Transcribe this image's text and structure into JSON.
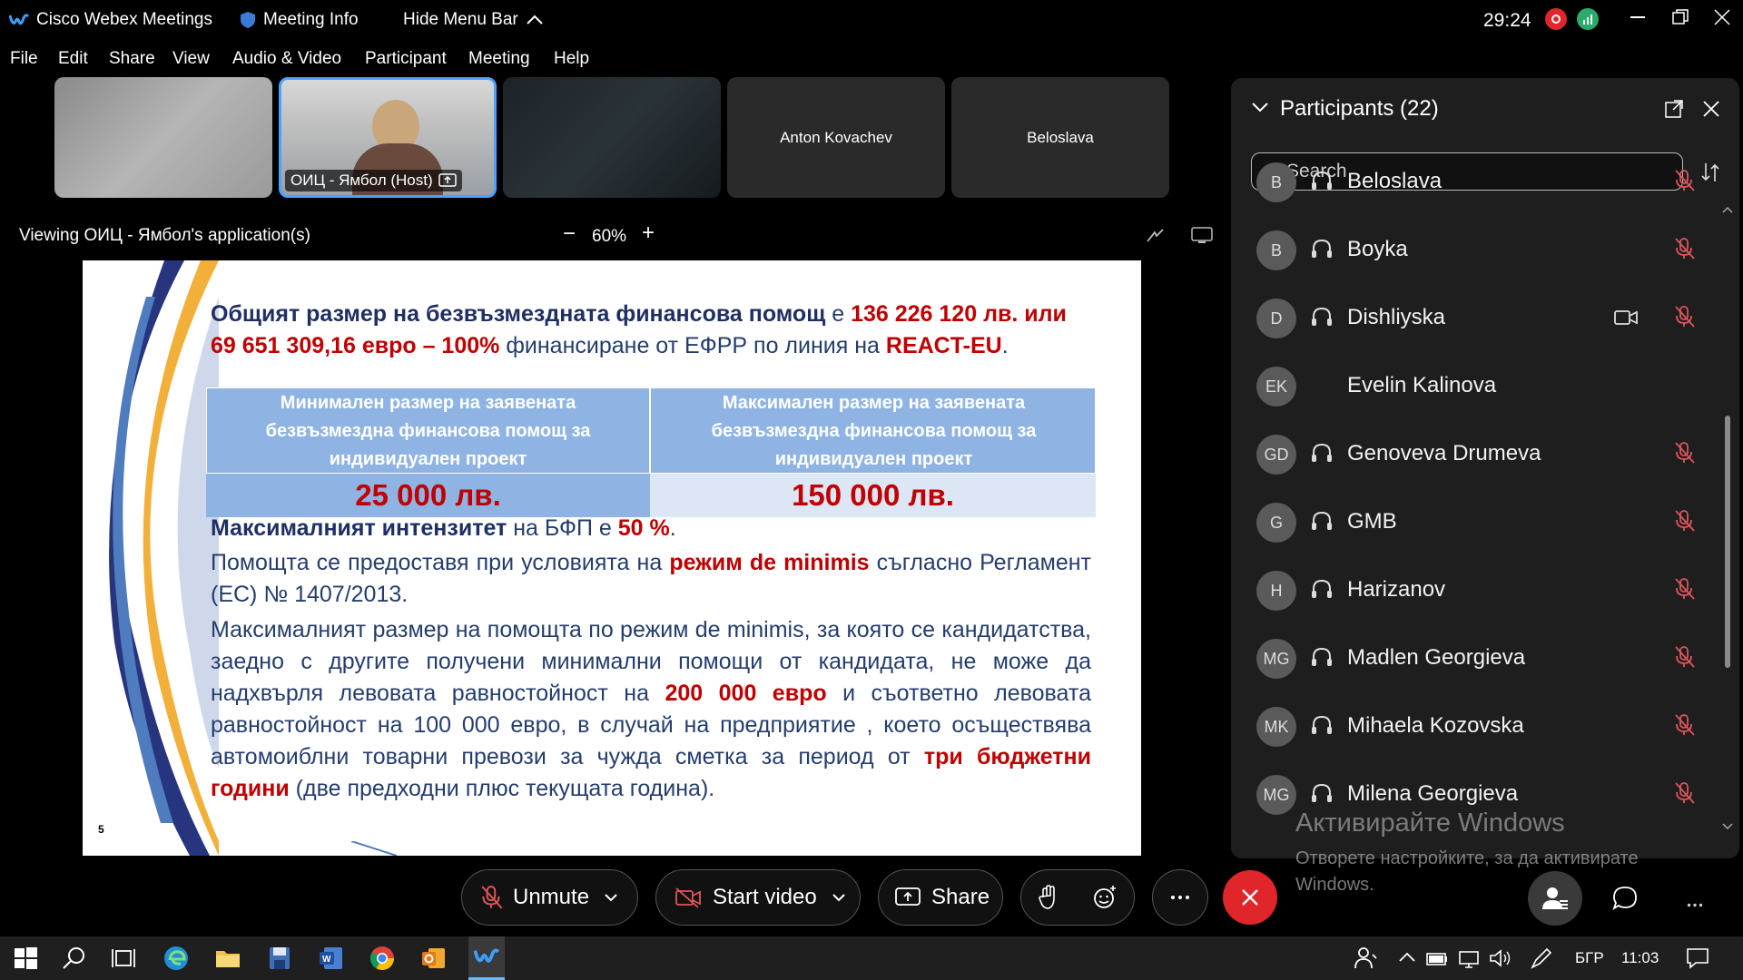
{
  "titlebar": {
    "app_title": "Cisco Webex Meetings",
    "meeting_info": "Meeting Info",
    "hide_menu": "Hide Menu Bar",
    "timer": "29:24"
  },
  "menu": [
    "File",
    "Edit",
    "Share",
    "View",
    "Audio & Video",
    "Participant",
    "Meeting",
    "Help"
  ],
  "thumbnails": [
    {
      "name": ""
    },
    {
      "name": "ОИЦ - Ямбол (Host)"
    },
    {
      "name": ""
    },
    {
      "name": "Anton Kovachev"
    },
    {
      "name": "Beloslava"
    }
  ],
  "sharebar": {
    "viewing": "Viewing ОИЦ - Ямбол's application(s)",
    "zoom": "60%"
  },
  "slide": {
    "p1_a": "Общият размер на безвъзмездната финансова помощ",
    "p1_b": " е ",
    "p1_c": "136 226 120 лв. или",
    "p1_d": "69 651 309,16 евро – 100%",
    "p1_e": " финансиране от ЕФРР по линия на ",
    "p1_f": "REACT-EU",
    "p1_g": ".",
    "th_left": "Минимален размер на заявената безвъзмездна финансова помощ за индивидуален проект",
    "th_right": "Максимален размер на заявената безвъзмездна финансова помощ за индивидуален проект",
    "td_left": "25 000 лв.",
    "td_right": "150 000 лв.",
    "p2_a": "Максималният интензитет",
    "p2_b": " на БФП е ",
    "p2_c": "50 %",
    "p2_d": ".",
    "p3_a": "Помощта се предоставя при условията на ",
    "p3_b": "режим de minimis",
    "p3_c": " съгласно Регламент (ЕС) № 1407/2013.",
    "p4_a": "Максималният размер на помощта по режим de minimis, за която се кандидатства, заедно с другите получени минимални помощи от кандидата, не може да надхвърля левовата равностойност на ",
    "p4_b": "200 000 евро",
    "p4_c": " и съответно левовата равностойност на 100 000 евро, в случай на предприятие , което осъществява автомоиблни товарни превози за чужда сметка за период от ",
    "p4_d": "три бюджетни години",
    "p4_e": " (две предходни плюс текущата година).",
    "page_number": "5"
  },
  "participants": {
    "title": "Participants (22)",
    "search_placeholder": "Search",
    "list": [
      {
        "initials": "B",
        "name": "Beloslava",
        "audio": true,
        "video": false
      },
      {
        "initials": "B",
        "name": "Boyka",
        "audio": true,
        "video": false
      },
      {
        "initials": "D",
        "name": "Dishliyska",
        "audio": true,
        "video": true
      },
      {
        "initials": "EK",
        "name": "Evelin Kalinova",
        "audio": false,
        "video": false
      },
      {
        "initials": "GD",
        "name": "Genoveva Drumeva",
        "audio": true,
        "video": false
      },
      {
        "initials": "G",
        "name": "GMB",
        "audio": true,
        "video": false
      },
      {
        "initials": "H",
        "name": "Harizanov",
        "audio": true,
        "video": false
      },
      {
        "initials": "MG",
        "name": "Madlen Georgieva",
        "audio": true,
        "video": false
      },
      {
        "initials": "MK",
        "name": "Mihaela Kozovska",
        "audio": true,
        "video": false
      },
      {
        "initials": "MG",
        "name": "Milena Georgieva",
        "audio": true,
        "video": false
      }
    ]
  },
  "controls": {
    "unmute": "Unmute",
    "start_video": "Start video",
    "share": "Share"
  },
  "watermark": {
    "line1": "Активирайте Windows",
    "line2": "Отворете настройките, за да активирате",
    "line3": "Windows."
  },
  "taskbar": {
    "lang": "БГР",
    "clock": "11:03"
  },
  "colors": {
    "accent_blue": "#4aa3ff",
    "end_red": "#e0262b",
    "slide_red": "#c00000",
    "slide_navy": "#1f2f66",
    "table_header": "#8fb4e3",
    "table_left_cell": "#8fb4e3",
    "table_right_cell": "#dde6f4"
  }
}
